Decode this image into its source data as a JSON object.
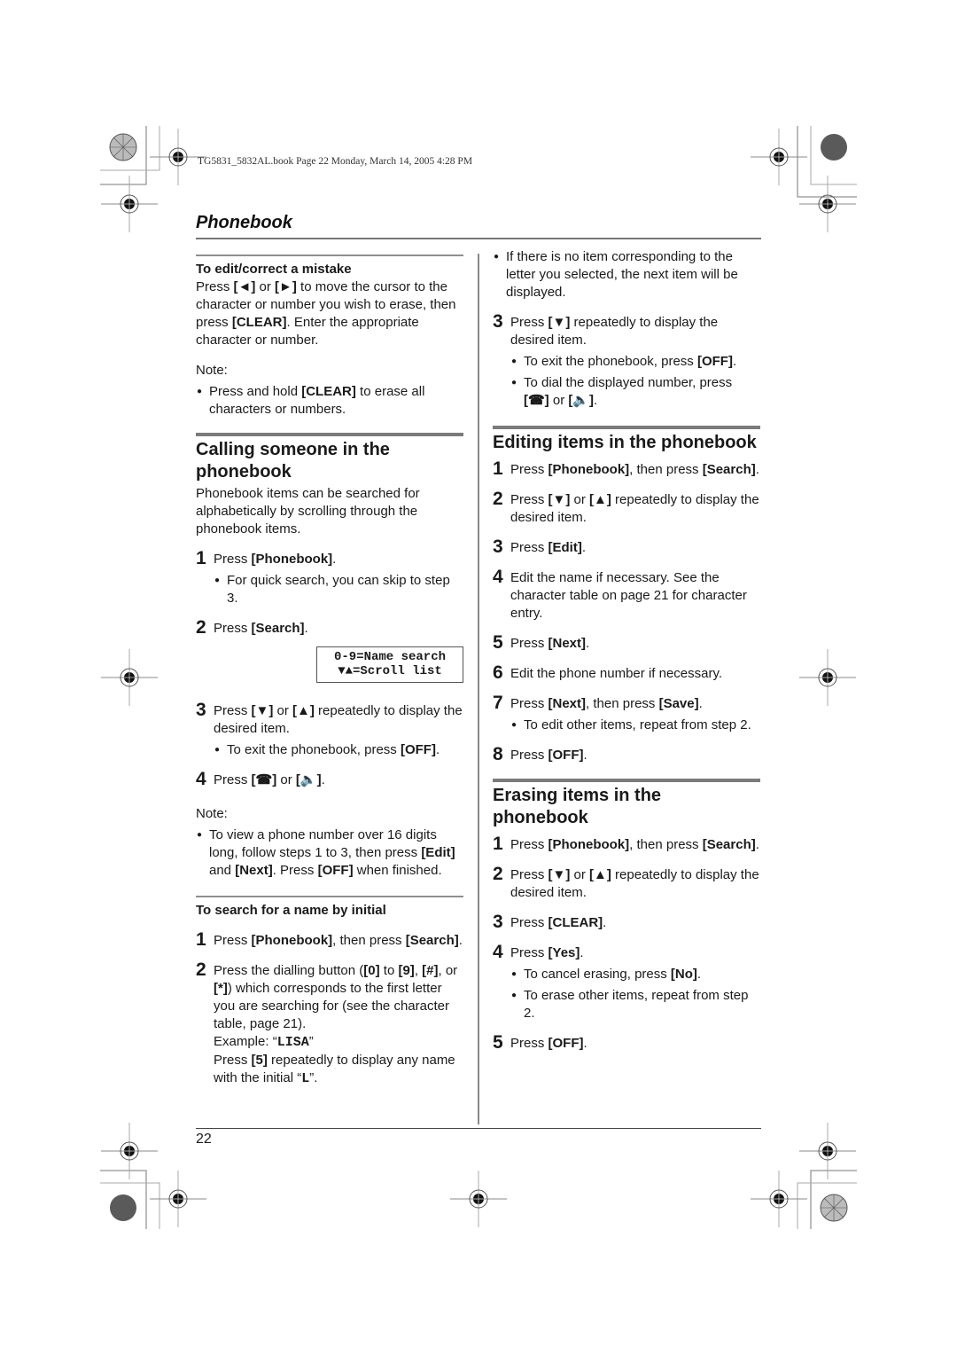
{
  "print_header": "TG5831_5832AL.book  Page 22  Monday, March 14, 2005  4:28 PM",
  "section_title": "Phonebook",
  "left_column": {
    "edit_heading": "To edit/correct a mistake",
    "edit_text": [
      "Press ",
      "[◄]",
      " or ",
      "[►]",
      " to move the cursor to the character or number you wish to erase, then press ",
      "[CLEAR]",
      ". Enter the appropriate character or number."
    ],
    "note_label": "Note:",
    "note1": [
      "Press and hold ",
      "[CLEAR]",
      " to erase all characters or numbers."
    ],
    "calling_heading": "Calling someone in the phonebook",
    "calling_intro": "Phonebook items can be searched for alphabetically by scrolling through the phonebook items.",
    "steps": [
      {
        "num": "1",
        "pre": "Press ",
        "key": "[Phonebook]",
        "post": ".",
        "bullet": "For quick search, you can skip to step 3."
      },
      {
        "num": "2",
        "pre": "Press ",
        "key": "[Search]",
        "post": "."
      },
      {
        "num": "3",
        "pre": "Press ",
        "key": "[▼]",
        "mid": " or ",
        "key2": "[▲]",
        "post": " repeatedly to display the desired item.",
        "bullet_pre": "To exit the phonebook, press ",
        "bullet_key": "[OFF]",
        "bullet_post": "."
      },
      {
        "num": "4",
        "pre": "Press ",
        "key": "[talk]",
        "mid": " or ",
        "key2": "[speaker]",
        "post": "."
      }
    ],
    "lcd_line1": "0-9=Name search",
    "lcd_line2": "▼▲=Scroll list",
    "note2_label": "Note:",
    "note2": [
      "To view a phone number over 16 digits long, follow steps 1 to 3, then press ",
      "[Edit]",
      " and ",
      "[Next]",
      ". Press ",
      "[OFF]",
      " when finished."
    ],
    "initial_heading": "To search for a name by initial",
    "initial_steps": [
      {
        "num": "1",
        "pre": "Press ",
        "key": "[Phonebook]",
        "mid": ", then press ",
        "key2": "[Search]",
        "post": "."
      },
      {
        "num": "2",
        "pre": "Press the dialling button (",
        "key": "[0]",
        "mid": " to ",
        "key2": "[9]",
        "mid2": ", ",
        "key3": "[#]",
        "mid3": ", or ",
        "key4": "[*]",
        "post": ") which corresponds to the first letter you are searching for (see the character table, page 21).",
        "example_label": "Example: “",
        "example_value": "LISA",
        "example_end": "”",
        "press_pre": "Press ",
        "press_key": "[5]",
        "press_post": " repeatedly to display any name with the initial “",
        "initial_value": "L",
        "initial_end": "”."
      }
    ]
  },
  "right_column": {
    "cont_bullet": "If there is no item corresponding to the letter you selected, the next item will be displayed.",
    "cont_step": {
      "num": "3",
      "pre": "Press ",
      "key": "[▼]",
      "post": " repeatedly to display the desired item.",
      "b1_pre": "To exit the phonebook, press ",
      "b1_key": "[OFF]",
      "b1_post": ".",
      "b2_pre": "To dial the displayed number, press ",
      "b2_key": "[talk]",
      "b2_mid": " or ",
      "b2_key2": "[speaker]",
      "b2_post": "."
    },
    "editing_heading": "Editing items in the phonebook",
    "editing_steps": [
      {
        "num": "1",
        "pre": "Press ",
        "key": "[Phonebook]",
        "mid": ", then press ",
        "key2": "[Search]",
        "post": "."
      },
      {
        "num": "2",
        "pre": "Press ",
        "key": "[▼]",
        "mid": " or ",
        "key2": "[▲]",
        "post": " repeatedly to display the desired item."
      },
      {
        "num": "3",
        "pre": "Press ",
        "key": "[Edit]",
        "post": "."
      },
      {
        "num": "4",
        "pre": "Edit the name if necessary. See the character table on page 21 for character entry."
      },
      {
        "num": "5",
        "pre": "Press ",
        "key": "[Next]",
        "post": "."
      },
      {
        "num": "6",
        "pre": "Edit the phone number if necessary."
      },
      {
        "num": "7",
        "pre": "Press ",
        "key": "[Next]",
        "mid": ", then press ",
        "key2": "[Save]",
        "post": ".",
        "bullet": "To edit other items, repeat from step 2."
      },
      {
        "num": "8",
        "pre": "Press ",
        "key": "[OFF]",
        "post": "."
      }
    ],
    "erasing_heading": "Erasing items in the phonebook",
    "erasing_steps": [
      {
        "num": "1",
        "pre": "Press ",
        "key": "[Phonebook]",
        "mid": ", then press ",
        "key2": "[Search]",
        "post": "."
      },
      {
        "num": "2",
        "pre": "Press ",
        "key": "[▼]",
        "mid": " or ",
        "key2": "[▲]",
        "post": " repeatedly to display the desired item."
      },
      {
        "num": "3",
        "pre": "Press ",
        "key": "[CLEAR]",
        "post": "."
      },
      {
        "num": "4",
        "pre": "Press ",
        "key": "[Yes]",
        "post": ".",
        "b1_pre": "To cancel erasing, press ",
        "b1_key": "[No]",
        "b1_post": ".",
        "b2": "To erase other items, repeat from step 2."
      },
      {
        "num": "5",
        "pre": "Press ",
        "key": "[OFF]",
        "post": "."
      }
    ]
  },
  "icons": {
    "talk": "[☎]",
    "speaker": "[🔈]"
  },
  "page_number": "22"
}
